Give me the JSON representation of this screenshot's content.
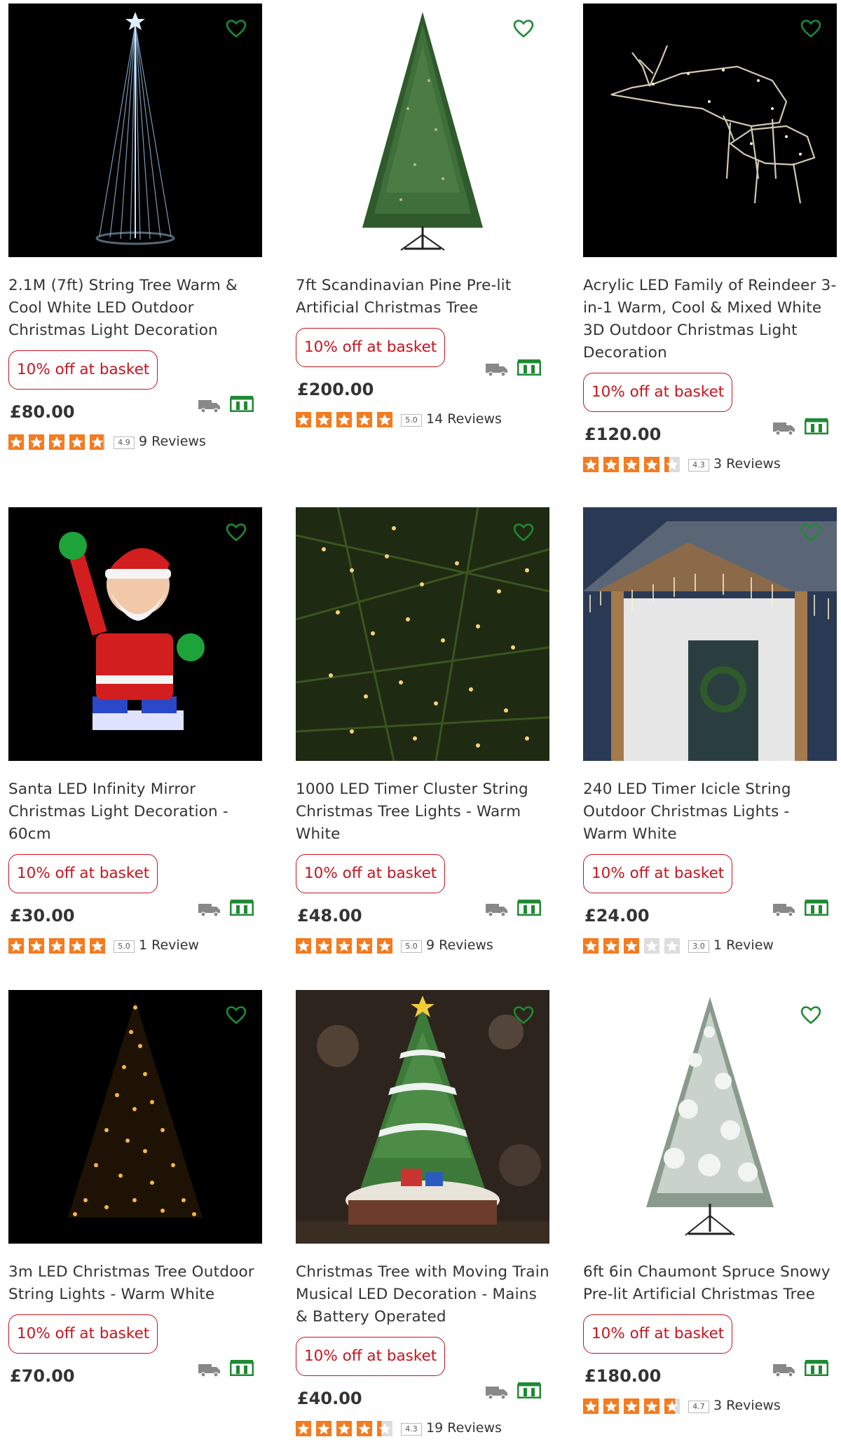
{
  "colors": {
    "promo_red": "#c8131c",
    "star_orange": "#f47b20",
    "star_empty": "#dddddd",
    "wishlist_green": "#1e8a33",
    "store_green": "#1e8a33",
    "truck_grey": "#888888"
  },
  "products": [
    {
      "title": "2.1M (7ft) String Tree Warm & Cool White LED Outdoor Christmas Light Decoration",
      "promo": "10% off at basket",
      "price": "£80.00",
      "rating": 4.9,
      "rating_label": "4.9",
      "reviews": "9 Reviews",
      "image": "string-light-cone-tree",
      "icons": [
        "heart-outline-icon",
        "delivery-truck-icon",
        "store-collect-icon"
      ]
    },
    {
      "title": "7ft Scandinavian Pine Pre-lit Artificial Christmas Tree",
      "promo": "10% off at basket",
      "price": "£200.00",
      "rating": 5.0,
      "rating_label": "5.0",
      "reviews": "14 Reviews",
      "image": "green-pine-tree",
      "icons": [
        "heart-outline-icon",
        "delivery-truck-icon",
        "store-collect-icon"
      ]
    },
    {
      "title": "Acrylic LED Family of Reindeer 3-in-1 Warm, Cool & Mixed White 3D Outdoor Christmas Light Decoration",
      "promo": "10% off at basket",
      "price": "£120.00",
      "rating": 4.3,
      "rating_label": "4.3",
      "reviews": "3 Reviews",
      "image": "led-reindeer",
      "icons": [
        "heart-outline-icon",
        "delivery-truck-icon",
        "store-collect-icon"
      ]
    },
    {
      "title": "Santa LED Infinity Mirror Christmas Light Decoration - 60cm",
      "promo": "10% off at basket",
      "price": "£30.00",
      "rating": 5.0,
      "rating_label": "5.0",
      "reviews": "1 Review",
      "image": "santa-infinity-mirror",
      "icons": [
        "heart-outline-icon",
        "delivery-truck-icon",
        "store-collect-icon"
      ]
    },
    {
      "title": "1000 LED Timer Cluster String Christmas Tree Lights - Warm White",
      "promo": "10% off at basket",
      "price": "£48.00",
      "rating": 5.0,
      "rating_label": "5.0",
      "reviews": "9 Reviews",
      "image": "cluster-lights-closeup",
      "icons": [
        "heart-outline-icon",
        "delivery-truck-icon",
        "store-collect-icon"
      ]
    },
    {
      "title": "240 LED Timer Icicle String Outdoor Christmas Lights - Warm White",
      "promo": "10% off at basket",
      "price": "£24.00",
      "rating": 3.0,
      "rating_label": "3.0",
      "reviews": "1 Review",
      "image": "icicle-porch-lights",
      "icons": [
        "heart-outline-icon",
        "delivery-truck-icon",
        "store-collect-icon"
      ]
    },
    {
      "title": "3m LED Christmas Tree Outdoor String Lights - Warm White",
      "promo": "10% off at basket",
      "price": "£70.00",
      "rating": null,
      "rating_label": "",
      "reviews": "",
      "image": "warm-light-tree",
      "icons": [
        "heart-outline-icon",
        "delivery-truck-icon",
        "store-collect-icon"
      ]
    },
    {
      "title": "Christmas Tree with Moving Train Musical LED Decoration - Mains & Battery Operated",
      "promo": "10% off at basket",
      "price": "£40.00",
      "rating": 4.3,
      "rating_label": "4.3",
      "reviews": "19 Reviews",
      "image": "train-tree-ornament",
      "icons": [
        "heart-outline-icon",
        "delivery-truck-icon",
        "store-collect-icon"
      ]
    },
    {
      "title": "6ft 6in Chaumont Spruce Snowy Pre-lit Artificial Christmas Tree",
      "promo": "10% off at basket",
      "price": "£180.00",
      "rating": 4.7,
      "rating_label": "4.7",
      "reviews": "3 Reviews",
      "image": "snowy-spruce-tree",
      "icons": [
        "heart-outline-icon",
        "delivery-truck-icon",
        "store-collect-icon"
      ]
    }
  ]
}
